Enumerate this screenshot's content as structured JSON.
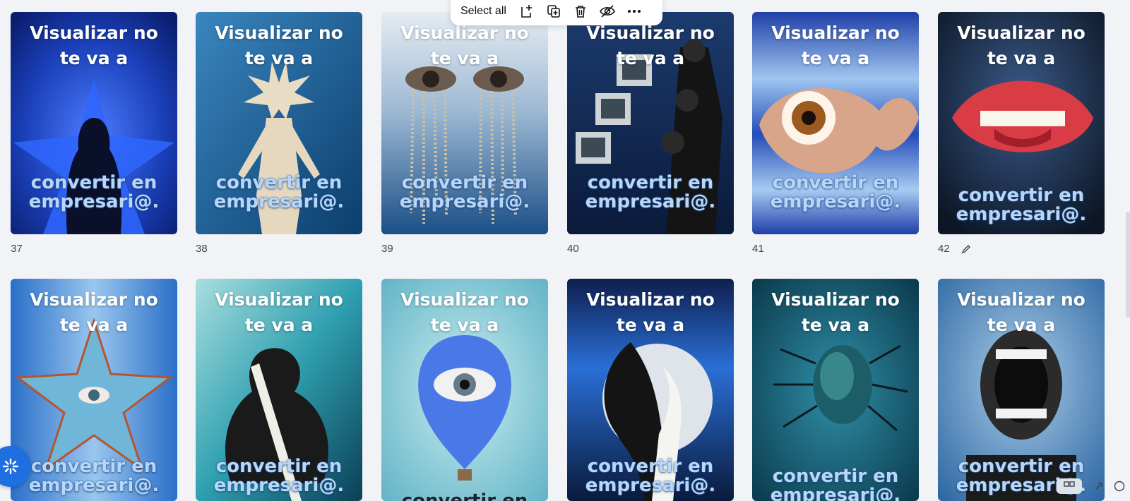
{
  "toolbar": {
    "select_all_label": "Select all",
    "icons": [
      "add-page-icon",
      "duplicate-icon",
      "trash-icon",
      "hide-icon",
      "more-icon"
    ]
  },
  "pages": [
    {
      "number": "37",
      "title_line1": "Visualizar no",
      "title_line2": "te va a",
      "footer_line1": "convertir en",
      "footer_line2": "empresari@."
    },
    {
      "number": "38",
      "title_line1": "Visualizar no",
      "title_line2": "te va a",
      "footer_line1": "convertir en",
      "footer_line2": "empresari@."
    },
    {
      "number": "39",
      "title_line1": "Visualizar no",
      "title_line2": "te va a",
      "footer_line1": "convertir en",
      "footer_line2": "empresari@."
    },
    {
      "number": "40",
      "title_line1": "Visualizar no",
      "title_line2": "te va a",
      "footer_line1": "convertir en",
      "footer_line2": "empresari@."
    },
    {
      "number": "41",
      "title_line1": "Visualizar no",
      "title_line2": "te va a",
      "footer_line1": "convertir en",
      "footer_line2": "empresari@."
    },
    {
      "number": "42",
      "title_line1": "Visualizar no",
      "title_line2": "te va a",
      "footer_line1": "convertir en",
      "footer_line2": "empresari@."
    },
    {
      "title_line1": "Visualizar no",
      "title_line2": "te va a",
      "footer_line1": "convertir en",
      "footer_line2": "empresari@."
    },
    {
      "title_line1": "Visualizar no",
      "title_line2": "te va a",
      "footer_line1": "convertir en",
      "footer_line2": "empresari@."
    },
    {
      "title_line1": "Visualizar no",
      "title_line2": "te va a",
      "footer_line1": "convertir en",
      "footer_line2": ""
    },
    {
      "title_line1": "Visualizar no",
      "title_line2": "te va a",
      "footer_line1": "convertir en",
      "footer_line2": "empresari@."
    },
    {
      "title_line1": "Visualizar no",
      "title_line2": "te va a",
      "footer_line1": "convertir en",
      "footer_line2": "empresari@."
    },
    {
      "title_line1": "Visualizar no",
      "title_line2": "te va a",
      "footer_line1": "convertir en",
      "footer_line2": "empresari@."
    }
  ],
  "colors": {
    "page_bg": "#f1f3f7",
    "accent_blue": "#1f6fe0",
    "title_text": "#ffffff",
    "footer_text": "#b8d6f7"
  }
}
